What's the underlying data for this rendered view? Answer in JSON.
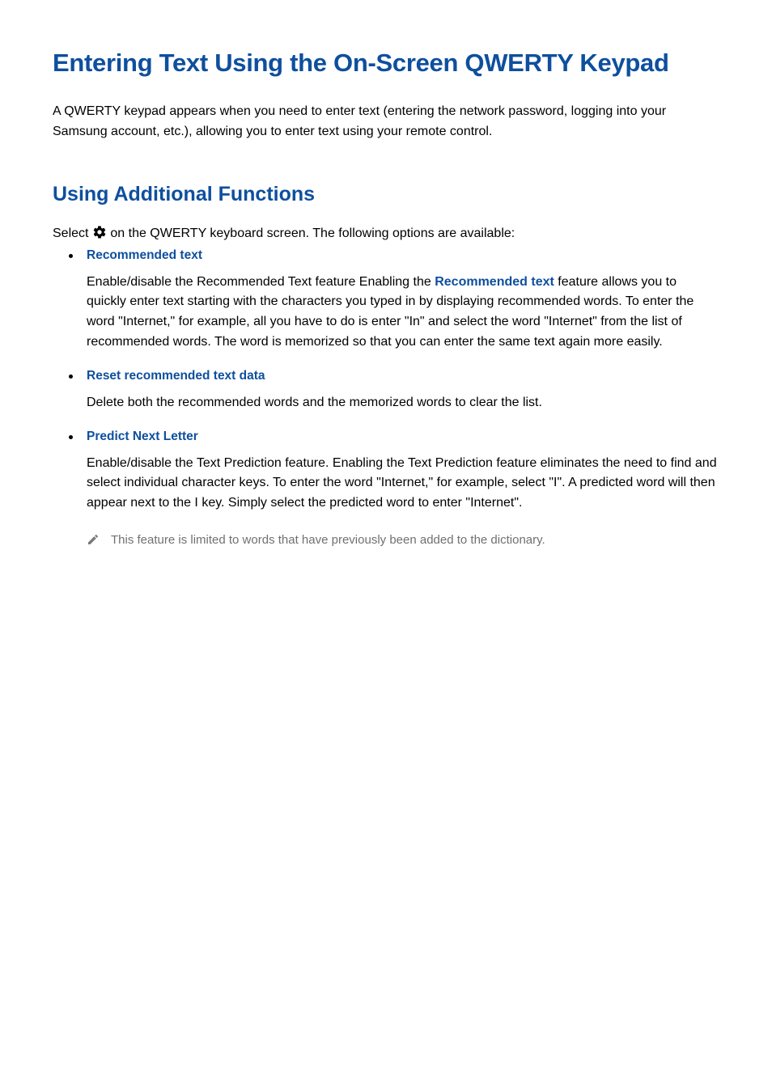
{
  "page": {
    "title": "Entering Text Using the On-Screen QWERTY Keypad",
    "intro": "A QWERTY keypad appears when you need to enter text (entering the network password, logging into your Samsung account, etc.), allowing you to enter text using your remote control."
  },
  "section": {
    "title": "Using Additional Functions",
    "intro_prefix": "Select ",
    "intro_suffix": " on the QWERTY keyboard screen. The following options are available:"
  },
  "features": [
    {
      "title": "Recommended text",
      "desc_prefix": "Enable/disable the Recommended Text feature Enabling the ",
      "desc_highlight": "Recommended text",
      "desc_suffix": " feature allows you to quickly enter text starting with the characters you typed in by displaying recommended words. To enter the word \"Internet,\" for example, all you have to do is enter \"In\" and select the word \"Internet\" from the list of recommended words. The word is memorized so that you can enter the same text again more easily."
    },
    {
      "title": "Reset recommended text data",
      "desc": "Delete both the recommended words and the memorized words to clear the list."
    },
    {
      "title": "Predict Next Letter",
      "desc": "Enable/disable the Text Prediction feature. Enabling the Text Prediction feature eliminates the need to find and select individual character keys. To enter the word \"Internet,\" for example, select \"I\". A predicted word will then appear next to the I key. Simply select the predicted word to enter \"Internet\".",
      "note": "This feature is limited to words that have previously been added to the dictionary."
    }
  ]
}
